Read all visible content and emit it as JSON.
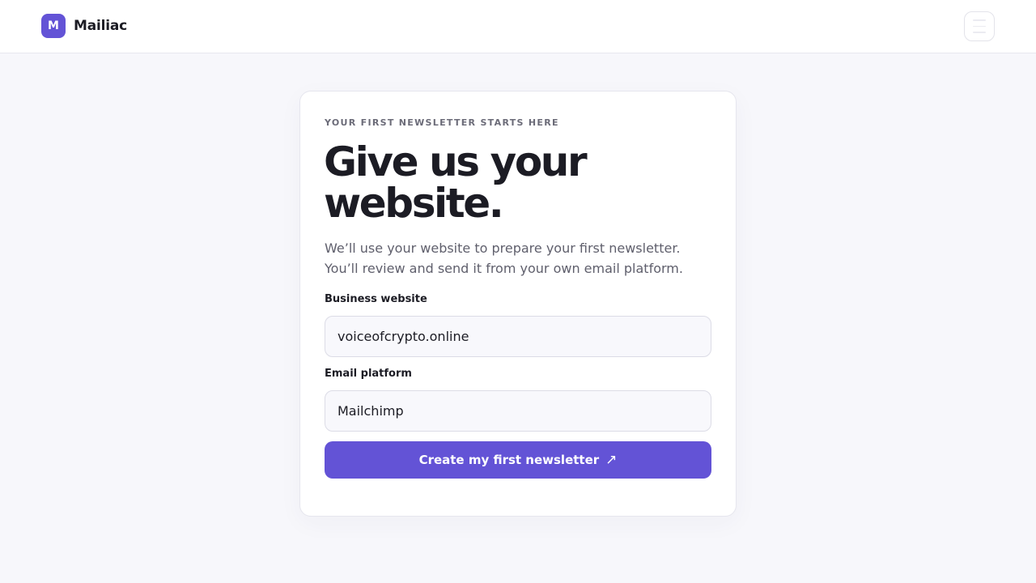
{
  "header": {
    "logo_letter": "M",
    "brand_name": "Mailiac",
    "menu_icon": "menu-icon"
  },
  "card": {
    "eyebrow": "YOUR FIRST NEWSLETTER STARTS HERE",
    "headline": "Give us your website.",
    "subcopy": "We’ll use your website to prepare your first newsletter. You’ll review and send it from your own email platform.",
    "fields": {
      "website": {
        "label": "Business website",
        "value": "voiceofcrypto.online"
      },
      "platform": {
        "label": "Email platform",
        "value": "Mailchimp"
      }
    },
    "cta": {
      "label": "Create my first newsletter",
      "icon": "↗"
    }
  },
  "colors": {
    "accent": "#6353d6",
    "page_background": "#f7f7fb",
    "card_background": "#ffffff",
    "text_primary": "#1c1c24",
    "text_secondary": "#5f5f6c"
  }
}
